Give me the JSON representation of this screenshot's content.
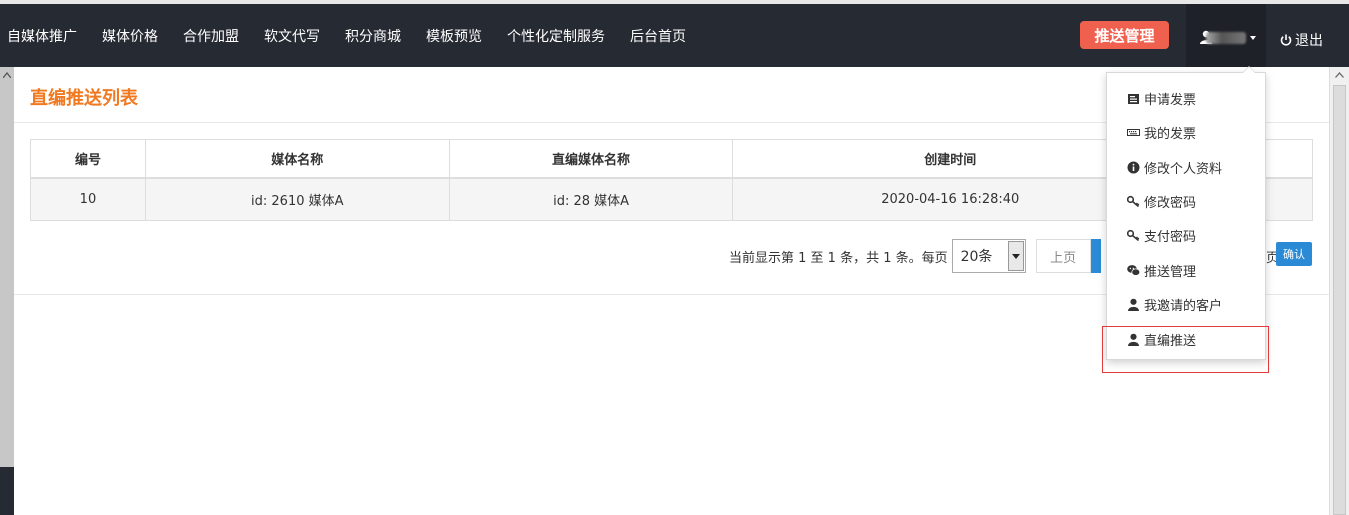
{
  "nav": {
    "items": [
      "自媒体推广",
      "媒体价格",
      "合作加盟",
      "软文代写",
      "积分商城",
      "模板预览",
      "个性化定制服务",
      "后台首页"
    ],
    "push_button": "推送管理",
    "logout": "退出"
  },
  "panel": {
    "title": "直编推送列表"
  },
  "table": {
    "headers": [
      "编号",
      "媒体名称",
      "直编媒体名称",
      "创建时间"
    ],
    "rows": [
      [
        "10",
        "id: 2610 媒体A",
        "id: 28 媒体A",
        "2020-04-16 16:28:40"
      ]
    ]
  },
  "pager": {
    "summary": "当前显示第 1 至 1 条，共 1 条。每页",
    "per_page": "20条",
    "prev": "上页",
    "suffix": "页",
    "confirm": "确认"
  },
  "dropdown": {
    "items": [
      {
        "label": "申请发票",
        "icon": "invoice-icon"
      },
      {
        "label": "我的发票",
        "icon": "keyboard-icon"
      },
      {
        "label": "修改个人资料",
        "icon": "info-icon"
      },
      {
        "label": "修改密码",
        "icon": "key-icon"
      },
      {
        "label": "支付密码",
        "icon": "key-icon"
      },
      {
        "label": "推送管理",
        "icon": "wechat-icon"
      },
      {
        "label": "我邀请的客户",
        "icon": "user-icon"
      },
      {
        "label": "直编推送",
        "icon": "user-icon"
      }
    ]
  },
  "colors": {
    "topbar": "#262a33",
    "accent_orange": "#f07a22",
    "push_button": "#f0604f",
    "primary_blue": "#2a8ad5",
    "highlight_red": "#e23c3c"
  }
}
